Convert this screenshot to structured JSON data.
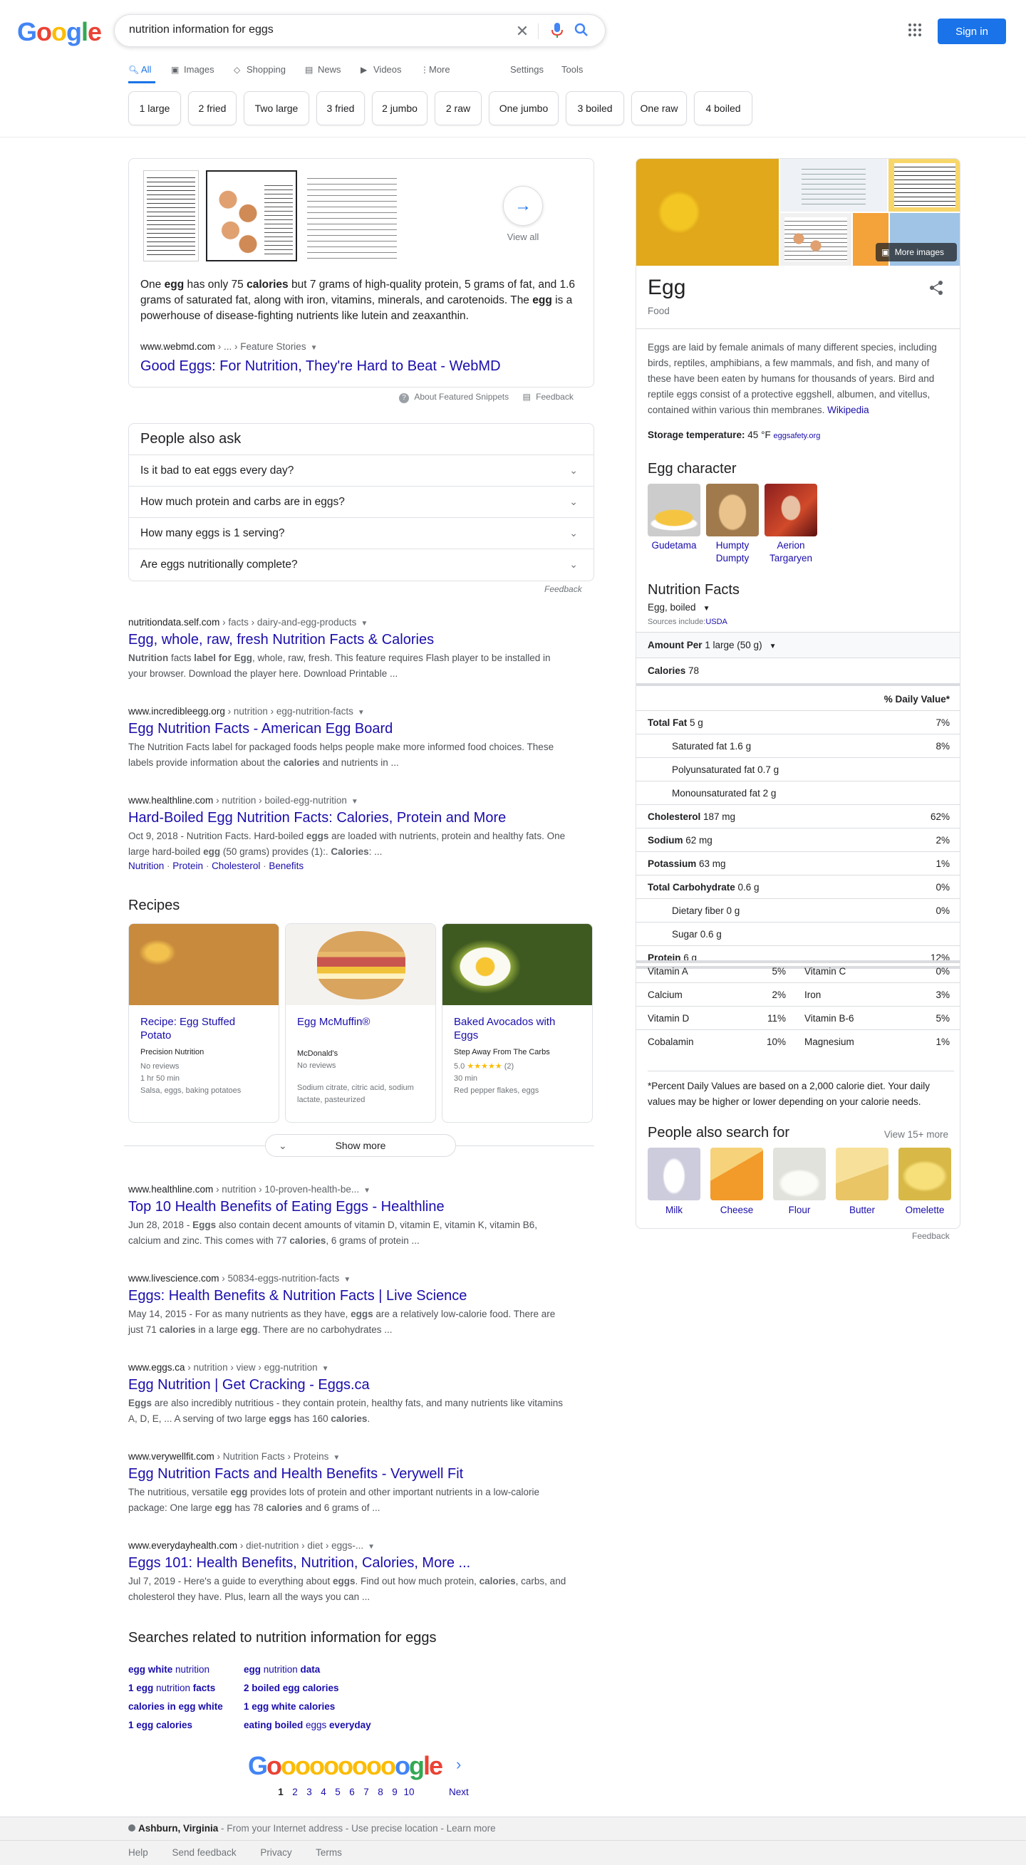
{
  "search": {
    "query": "nutrition information for eggs",
    "signin_label": "Sign in"
  },
  "tabs": {
    "all": "All",
    "images": "Images",
    "shopping": "Shopping",
    "news": "News",
    "videos": "Videos",
    "more": "More",
    "settings": "Settings",
    "tools": "Tools"
  },
  "chips": [
    "1 large",
    "2 fried",
    "Two large",
    "3 fried",
    "2 jumbo",
    "2 raw",
    "One jumbo",
    "3 boiled",
    "One raw",
    "4 boiled"
  ],
  "snippet": {
    "view_all": "View all",
    "text_parts": [
      "One ",
      "egg",
      " has only 75 ",
      "calories",
      " but 7 grams of high-quality protein, 5 grams of fat, and 1.6 grams of saturated fat, along with iron, vitamins, minerals, and carotenoids. The ",
      "egg",
      " is a powerhouse of disease-fighting nutrients like lutein and zeaxanthin."
    ],
    "cite_domain": "www.webmd.com",
    "cite_path": " › ... › Feature Stories",
    "title": "Good Eggs: For Nutrition, They're Hard to Beat - WebMD",
    "about": "About Featured Snippets",
    "feedback": "Feedback"
  },
  "paa": {
    "heading": "People also ask",
    "questions": [
      "Is it bad to eat eggs every day?",
      "How much protein and carbs are in eggs?",
      "How many eggs is 1 serving?",
      "Are eggs nutritionally complete?"
    ],
    "feedback": "Feedback"
  },
  "results": [
    {
      "domain": "nutritiondata.self.com",
      "path": " › facts › dairy-and-egg-products",
      "title": "Egg, whole, raw, fresh Nutrition Facts & Calories",
      "desc_html": "<b>Nutrition</b> facts <b>label for Egg</b>, whole, raw, fresh. This feature requires Flash player to be installed in your browser. Download the player here. Download Printable ..."
    },
    {
      "domain": "www.incredibleegg.org",
      "path": " › nutrition › egg-nutrition-facts",
      "title": "Egg Nutrition Facts - American Egg Board",
      "desc_html": "The Nutrition Facts label for packaged foods helps people make more informed food choices. These labels provide information about the <b>calories</b> and nutrients in ..."
    },
    {
      "domain": "www.healthline.com",
      "path": " › nutrition › boiled-egg-nutrition",
      "title": "Hard-Boiled Egg Nutrition Facts: Calories, Protein and More",
      "desc_html": "Oct 9, 2018 - Nutrition Facts. Hard-boiled <b>eggs</b> are loaded with nutrients, protein and healthy fats. One large hard-boiled <b>egg</b> (50 grams) provides (1):. <b>Calories</b>: ...",
      "sitelinks": [
        "Nutrition",
        "Protein",
        "Cholesterol",
        "Benefits"
      ]
    }
  ],
  "recipes": {
    "heading": "Recipes",
    "items": [
      {
        "title": "Recipe: Egg Stuffed Potato",
        "source": "Precision Nutrition",
        "reviews": "No reviews",
        "time": "1 hr 50 min",
        "ingredients": "Salsa, eggs, baking potatoes"
      },
      {
        "title": "Egg McMuffin®",
        "source": "McDonald's",
        "reviews": "No reviews",
        "time": "",
        "ingredients": "Sodium citrate, citric acid, sodium lactate, pasteurized"
      },
      {
        "title": "Baked Avocados with Eggs",
        "source": "Step Away From The Carbs",
        "rating": "5.0",
        "stars": "★★★★★",
        "count": "(2)",
        "time": "30 min",
        "ingredients": "Red pepper flakes, eggs"
      }
    ],
    "show_more": "Show more"
  },
  "results2": [
    {
      "domain": "www.healthline.com",
      "path": " › nutrition › 10-proven-health-be...",
      "title": "Top 10 Health Benefits of Eating Eggs - Healthline",
      "desc_html": "Jun 28, 2018 - <b>Eggs</b> also contain decent amounts of vitamin D, vitamin E, vitamin K, vitamin B6, calcium and zinc. This comes with 77 <b>calories</b>, 6 grams of protein ..."
    },
    {
      "domain": "www.livescience.com",
      "path": " › 50834-eggs-nutrition-facts",
      "title": "Eggs: Health Benefits & Nutrition Facts | Live Science",
      "desc_html": "May 14, 2015 - For as many nutrients as they have, <b>eggs</b> are a relatively low-calorie food. There are just 71 <b>calories</b> in a large <b>egg</b>. There are no carbohydrates ..."
    },
    {
      "domain": "www.eggs.ca",
      "path": " › nutrition › view › egg-nutrition",
      "title": "Egg Nutrition | Get Cracking - Eggs.ca",
      "desc_html": "<b>Eggs</b> are also incredibly nutritious - they contain protein, healthy fats, and many nutrients like vitamins A, D, E, ... A serving of two large <b>eggs</b> has 160 <b>calories</b>."
    },
    {
      "domain": "www.verywellfit.com",
      "path": " › Nutrition Facts › Proteins",
      "title": "Egg Nutrition Facts and Health Benefits - Verywell Fit",
      "desc_html": "The nutritious, versatile <b>egg</b> provides lots of protein and other important nutrients in a low-calorie package: One large <b>egg</b> has 78 <b>calories</b> and 6 grams of ..."
    },
    {
      "domain": "www.everydayhealth.com",
      "path": " › diet-nutrition › diet › eggs-...",
      "title": "Eggs 101: Health Benefits, Nutrition, Calories, More ...",
      "desc_html": "Jul 7, 2019 - Here's a guide to everything about <b>eggs</b>. Find out how much protein, <b>calories</b>, carbs, and cholesterol they have. Plus, learn all the ways you can ..."
    }
  ],
  "related": {
    "heading": "Searches related to nutrition information for eggs",
    "col1": [
      "<b>egg white</b> nutrition",
      "<b>1 egg</b> nutrition <b>facts</b>",
      "<b>calories in egg white</b>",
      "<b>1 egg calories</b>"
    ],
    "col2": [
      "<b>egg</b> nutrition <b>data</b>",
      "<b>2 boiled egg calories</b>",
      "<b>1 egg white calories</b>",
      "<b>eating boiled</b> eggs <b>everyday</b>"
    ]
  },
  "pager": {
    "letters": "Goooooooooogle",
    "pages": [
      "1",
      "2",
      "3",
      "4",
      "5",
      "6",
      "7",
      "8",
      "9",
      "10"
    ],
    "next": "Next"
  },
  "footer": {
    "location": "Ashburn, Virginia",
    "location_rest": " - From your Internet address - Use precise location - Learn more",
    "links": [
      "Help",
      "Send feedback",
      "Privacy",
      "Terms"
    ]
  },
  "kp": {
    "more_images": "More images",
    "title": "Egg",
    "subtitle": "Food",
    "desc": "Eggs are laid by female animals of many different species, including birds, reptiles, amphibians, a few mammals, and fish, and many of these have been eaten by humans for thousands of years. Bird and reptile eggs consist of a protective eggshell, albumen, and vitellus, contained within various thin membranes. ",
    "wiki": "Wikipedia",
    "storage_label": "Storage temperature:",
    "storage_value": " 45 °F ",
    "storage_src": "eggsafety.org",
    "character_heading": "Egg character",
    "characters": [
      "Gudetama",
      "Humpty Dumpty",
      "Aerion Targaryen"
    ],
    "nutrition_heading": "Nutrition Facts",
    "variant": "Egg, boiled",
    "sources_label": "Sources include:",
    "sources_link": "USDA",
    "amount_label": "Amount Per",
    "amount_value": " 1 large (50 g)",
    "calories_label": "Calories",
    "calories_value": " 78",
    "dv_heading": "% Daily Value*",
    "rows": [
      {
        "label": "Total Fat",
        "amt": " 5 g",
        "dv": "7%",
        "bold": true
      },
      {
        "label": "Saturated fat 1.6 g",
        "amt": "",
        "dv": "8%",
        "bold": false
      },
      {
        "label": "Polyunsaturated fat 0.7 g",
        "amt": "",
        "dv": "",
        "bold": false
      },
      {
        "label": "Monounsaturated fat 2 g",
        "amt": "",
        "dv": "",
        "bold": false
      },
      {
        "label": "Cholesterol",
        "amt": " 187 mg",
        "dv": "62%",
        "bold": true
      },
      {
        "label": "Sodium",
        "amt": " 62 mg",
        "dv": "2%",
        "bold": true
      },
      {
        "label": "Potassium",
        "amt": " 63 mg",
        "dv": "1%",
        "bold": true
      },
      {
        "label": "Total Carbohydrate",
        "amt": " 0.6 g",
        "dv": "0%",
        "bold": true
      },
      {
        "label": "Dietary fiber 0 g",
        "amt": "",
        "dv": "0%",
        "bold": false
      },
      {
        "label": "Sugar 0.6 g",
        "amt": "",
        "dv": "",
        "bold": false
      },
      {
        "label": "Protein",
        "amt": " 6 g",
        "dv": "12%",
        "bold": true
      }
    ],
    "vitamins": [
      [
        "Vitamin A",
        "5%",
        "Vitamin C",
        "0%"
      ],
      [
        "Calcium",
        "2%",
        "Iron",
        "3%"
      ],
      [
        "Vitamin D",
        "11%",
        "Vitamin B-6",
        "5%"
      ],
      [
        "Cobalamin",
        "10%",
        "Magnesium",
        "1%"
      ]
    ],
    "footnote": "*Percent Daily Values are based on a 2,000 calorie diet. Your daily values may be higher or lower depending on your calorie needs.",
    "pas_heading": "People also search for",
    "pas_more": "View 15+ more",
    "pas": [
      "Milk",
      "Cheese",
      "Flour",
      "Butter",
      "Omelette"
    ],
    "feedback": "Feedback"
  },
  "colors": {
    "blue": "#4285f4",
    "red": "#ea4335",
    "yellow": "#fbbc05",
    "green": "#34a853",
    "link": "#1a0dab",
    "accent": "#1a73e8"
  }
}
